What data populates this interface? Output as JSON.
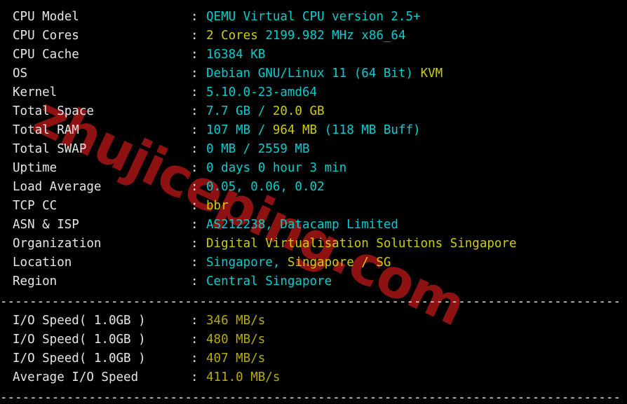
{
  "terminal": {
    "colors": {
      "background": "#000000",
      "label": "#e6e6e6",
      "cyan": "#00cdcd",
      "gold": "#cdcd00",
      "olive": "#b5ac00",
      "watermark": "#8f1212"
    },
    "watermark_text": "zhujiceping.com",
    "separator": "-------------------------------------------------------------------------"
  },
  "system_info": {
    "rows": [
      {
        "label": "CPU Model",
        "separator": ":",
        "segments": [
          {
            "text": "QEMU Virtual CPU version 2.5+",
            "color": "cyan"
          }
        ]
      },
      {
        "label": "CPU Cores",
        "separator": ":",
        "segments": [
          {
            "text": "2 Cores",
            "color": "gold"
          },
          {
            "text": " ",
            "color": "white"
          },
          {
            "text": "2199.982 MHz x86_64",
            "color": "cyan"
          }
        ]
      },
      {
        "label": "CPU Cache",
        "separator": ":",
        "segments": [
          {
            "text": "16384 KB",
            "color": "cyan"
          }
        ]
      },
      {
        "label": "OS",
        "separator": ":",
        "segments": [
          {
            "text": "Debian GNU/Linux 11 (64 Bit)",
            "color": "cyan"
          },
          {
            "text": " ",
            "color": "white"
          },
          {
            "text": "KVM",
            "color": "gold"
          }
        ]
      },
      {
        "label": "Kernel",
        "separator": ":",
        "segments": [
          {
            "text": "5.10.0-23-amd64",
            "color": "cyan"
          }
        ]
      },
      {
        "label": "Total Space",
        "separator": ":",
        "segments": [
          {
            "text": "7.7 GB",
            "color": "cyan"
          },
          {
            "text": " / ",
            "color": "cyan"
          },
          {
            "text": "20.0 GB",
            "color": "gold"
          }
        ]
      },
      {
        "label": "Total RAM",
        "separator": ":",
        "segments": [
          {
            "text": "107 MB",
            "color": "cyan"
          },
          {
            "text": " / ",
            "color": "cyan"
          },
          {
            "text": "964 MB",
            "color": "gold"
          },
          {
            "text": " (118 MB Buff)",
            "color": "cyan"
          }
        ]
      },
      {
        "label": "Total SWAP",
        "separator": ":",
        "segments": [
          {
            "text": "0 MB / 2559 MB",
            "color": "cyan"
          }
        ]
      },
      {
        "label": "Uptime",
        "separator": ":",
        "segments": [
          {
            "text": "0 days 0 hour 3 min",
            "color": "cyan"
          }
        ]
      },
      {
        "label": "Load Average",
        "separator": ":",
        "segments": [
          {
            "text": "0.05, 0.06, 0.02",
            "color": "cyan"
          }
        ]
      },
      {
        "label": "TCP CC",
        "separator": ":",
        "segments": [
          {
            "text": "bbr",
            "color": "gold"
          }
        ]
      },
      {
        "label": "ASN & ISP",
        "separator": ":",
        "segments": [
          {
            "text": "AS212238, Datacamp Limited",
            "color": "cyan"
          }
        ]
      },
      {
        "label": "Organization",
        "separator": ":",
        "segments": [
          {
            "text": "Digital Virtualisation Solutions Singapore",
            "color": "gold"
          }
        ]
      },
      {
        "label": "Location",
        "separator": ":",
        "segments": [
          {
            "text": "Singapore, ",
            "color": "cyan"
          },
          {
            "text": "Singapore / SG",
            "color": "gold"
          }
        ]
      },
      {
        "label": "Region",
        "separator": ":",
        "segments": [
          {
            "text": "Central Singapore",
            "color": "cyan"
          }
        ]
      }
    ]
  },
  "io_benchmark": {
    "rows": [
      {
        "label": "I/O Speed( 1.0GB )",
        "separator": ":",
        "segments": [
          {
            "text": "346 MB/s",
            "color": "olive"
          }
        ]
      },
      {
        "label": "I/O Speed( 1.0GB )",
        "separator": ":",
        "segments": [
          {
            "text": "480 MB/s",
            "color": "olive"
          }
        ]
      },
      {
        "label": "I/O Speed( 1.0GB )",
        "separator": ":",
        "segments": [
          {
            "text": "407 MB/s",
            "color": "olive"
          }
        ]
      },
      {
        "label": "Average I/O Speed",
        "separator": ":",
        "segments": [
          {
            "text": "411.0 MB/s",
            "color": "olive"
          }
        ]
      }
    ]
  }
}
